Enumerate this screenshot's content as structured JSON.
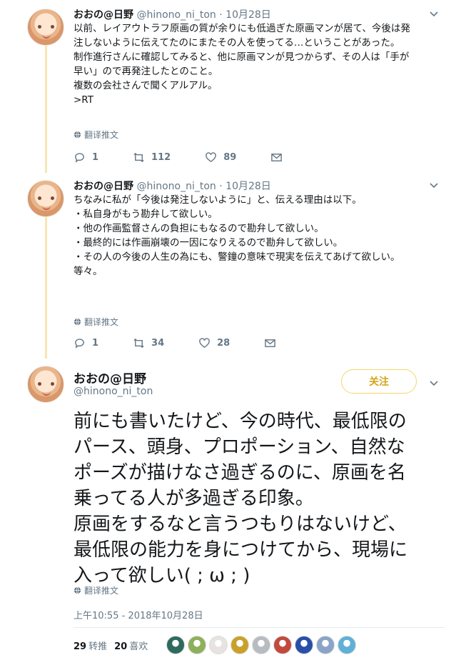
{
  "tweet1": {
    "name": "おおの@日野",
    "handle": "@hinono_ni_ton",
    "sep": "·",
    "date": "10月28日",
    "lines": [
      "以前、レイアウトラフ原画の質が余りにも低過ぎた原画マンが居て、今後は発",
      "注しないように伝えてたのにまたその人を使ってる…ということがあった。",
      "制作進行さんに確認してみると、他に原画マンが見つからず、その人は「手が",
      "早い」ので再発注したとのこと。",
      "",
      "複数の会社さんで聞くアルアル。",
      ">RT"
    ],
    "translate": "翻译推文",
    "replies": "1",
    "retweets": "112",
    "likes": "89"
  },
  "tweet2": {
    "name": "おおの@日野",
    "handle": "@hinono_ni_ton",
    "sep": "·",
    "date": "10月28日",
    "lines": [
      "ちなみに私が「今後は発注しないように」と、伝える理由は以下。",
      "",
      "・私自身がもう勘弁して欲しい。",
      "・他の作画監督さんの負担にもなるので勘弁して欲しい。",
      "・最終的には作画崩壊の一因になりえるので勘弁して欲しい。",
      "・その人の今後の人生の為にも、警鐘の意味で現実を伝えてあげて欲しい。",
      "",
      "等々。"
    ],
    "translate": "翻译推文",
    "replies": "1",
    "retweets": "34",
    "likes": "28"
  },
  "main": {
    "name": "おおの@日野",
    "handle": "@hinono_ni_ton",
    "follow_label": "关注",
    "lines": [
      "前にも書いたけど、今の時代、最低限の",
      "パース、頭身、プロポーション、自然な",
      "ポーズが描けなさ過ぎるのに、原画を名",
      "乗ってる人が多過ぎる印象。",
      "原画をするなと言うつもりはないけど、",
      "最低限の能力を身につけてから、現場に",
      "入って欲しい( ; ω ; )"
    ],
    "translate": "翻译推文",
    "timestamp": "上午10:55 - 2018年10月28日",
    "retweet_count": "29",
    "retweet_label": "转推",
    "like_count": "20",
    "like_label": "喜欢"
  },
  "colors": {
    "thread_line": "#f6e7b4",
    "follow_accent": "#d1a519",
    "muted": "#657786"
  },
  "liker_colors": [
    "#2e6b5e",
    "#8fb05a",
    "#e8e3e0",
    "#c9a12a",
    "#b7bcc2",
    "#c24a3c",
    "#2a4fa8",
    "#8aa4c8",
    "#5fb0d8"
  ]
}
